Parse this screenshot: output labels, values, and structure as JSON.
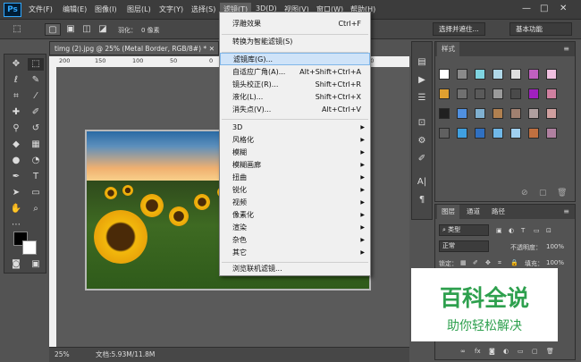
{
  "app": {
    "logo": "Ps"
  },
  "menubar": {
    "items": [
      "文件(F)",
      "编辑(E)",
      "图像(I)",
      "图层(L)",
      "文字(Y)",
      "选择(S)",
      "滤镜(T)",
      "3D(D)",
      "视图(V)",
      "窗口(W)",
      "帮助(H)"
    ],
    "window_buttons": [
      "—",
      "□",
      "✕"
    ]
  },
  "options_bar": {
    "feather_label": "羽化：",
    "feather_value": "0 像素",
    "select_mask_button": "选择并遮住...",
    "workspace_value": "基本功能"
  },
  "document": {
    "tab_title": "timg (2).jpg @ 25% (Metal Border, RGB/8#) *",
    "ruler_marks": [
      "200",
      "150",
      "100",
      "50",
      "0",
      "50",
      "100",
      "150",
      "200"
    ]
  },
  "status_bar": {
    "zoom": "25%",
    "doc_info": "文档:5.93M/11.8M"
  },
  "filter_menu": {
    "items": [
      {
        "label": "浮雕效果",
        "shortcut": "Ctrl+F"
      },
      {
        "label": "转换为智能滤镜(S)",
        "shortcut": ""
      },
      {
        "label": "滤镜库(G)...",
        "shortcut": ""
      },
      {
        "label": "自适应广角(A)...",
        "shortcut": "Alt+Shift+Ctrl+A"
      },
      {
        "label": "镜头校正(R)...",
        "shortcut": "Shift+Ctrl+R"
      },
      {
        "label": "液化(L)...",
        "shortcut": "Shift+Ctrl+X"
      },
      {
        "label": "消失点(V)...",
        "shortcut": "Alt+Ctrl+V"
      },
      {
        "label": "3D",
        "shortcut": ""
      },
      {
        "label": "风格化",
        "shortcut": ""
      },
      {
        "label": "模糊",
        "shortcut": ""
      },
      {
        "label": "模糊画廊",
        "shortcut": ""
      },
      {
        "label": "扭曲",
        "shortcut": ""
      },
      {
        "label": "锐化",
        "shortcut": ""
      },
      {
        "label": "视频",
        "shortcut": ""
      },
      {
        "label": "像素化",
        "shortcut": ""
      },
      {
        "label": "渲染",
        "shortcut": ""
      },
      {
        "label": "杂色",
        "shortcut": ""
      },
      {
        "label": "其它",
        "shortcut": ""
      },
      {
        "label": "浏览联机滤镜...",
        "shortcut": ""
      }
    ]
  },
  "styles_panel": {
    "tab": "样式"
  },
  "layers_panel": {
    "tabs": [
      "图层",
      "通道",
      "路径"
    ],
    "filter_kind": "类型",
    "blend_mode": "正常",
    "opacity_label": "不透明度：",
    "opacity_value": "100%",
    "lock_label": "锁定：",
    "fill_label": "填充：",
    "fill_value": "100%"
  },
  "watermark": {
    "title": "百科全说",
    "subtitle": "助你轻松解决"
  },
  "colors": {
    "accent": "#31a8ff",
    "menu_highlight": "#cfe3f8",
    "watermark_green": "#2ea04e"
  }
}
